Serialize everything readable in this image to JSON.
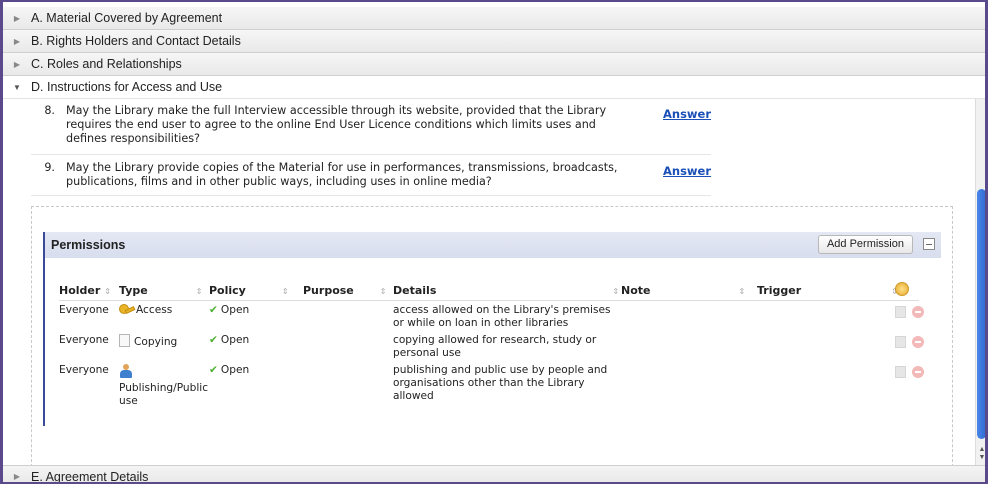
{
  "sections": {
    "a": {
      "label": "A. Material Covered by Agreement"
    },
    "b": {
      "label": "B. Rights Holders and Contact Details"
    },
    "c": {
      "label": "C. Roles and Relationships"
    },
    "d": {
      "label": "D. Instructions for Access and Use"
    },
    "e": {
      "label": "E. Agreement Details"
    }
  },
  "questions": [
    {
      "num": "8.",
      "text": "May the Library make the full Interview accessible through its website, provided that the Library requires the end user to agree to the online End User Licence conditions which limits uses and defines responsibilities?",
      "answer": "Answer"
    },
    {
      "num": "9.",
      "text": "May the Library provide copies of the Material for use in performances, transmissions, broadcasts, publications, films and in other public ways, including uses in online media?",
      "answer": "Answer"
    }
  ],
  "permissions": {
    "title": "Permissions",
    "add_label": "Add Permission",
    "columns": [
      "Holder",
      "Type",
      "Policy",
      "Purpose",
      "Details",
      "Note",
      "Trigger"
    ],
    "rows": [
      {
        "holder": "Everyone",
        "type": "Access",
        "type_icon": "key-icon",
        "policy": "Open",
        "details": "access allowed on the Library's premises or while on loan in other libraries"
      },
      {
        "holder": "Everyone",
        "type": "Copying",
        "type_icon": "document-icon",
        "policy": "Open",
        "details": "copying allowed for research, study or personal use"
      },
      {
        "holder": "Everyone",
        "type": "Publishing/Public use",
        "type_icon": "person-icon",
        "policy": "Open",
        "details": "publishing and public use by people and organisations other than the Library allowed"
      }
    ]
  },
  "colors": {
    "accent": "#1a4fb8",
    "panel_border": "#3a4a99",
    "frame": "#5b4a8b",
    "scroll_thumb": "#3476dc",
    "check": "#4caf2f"
  }
}
